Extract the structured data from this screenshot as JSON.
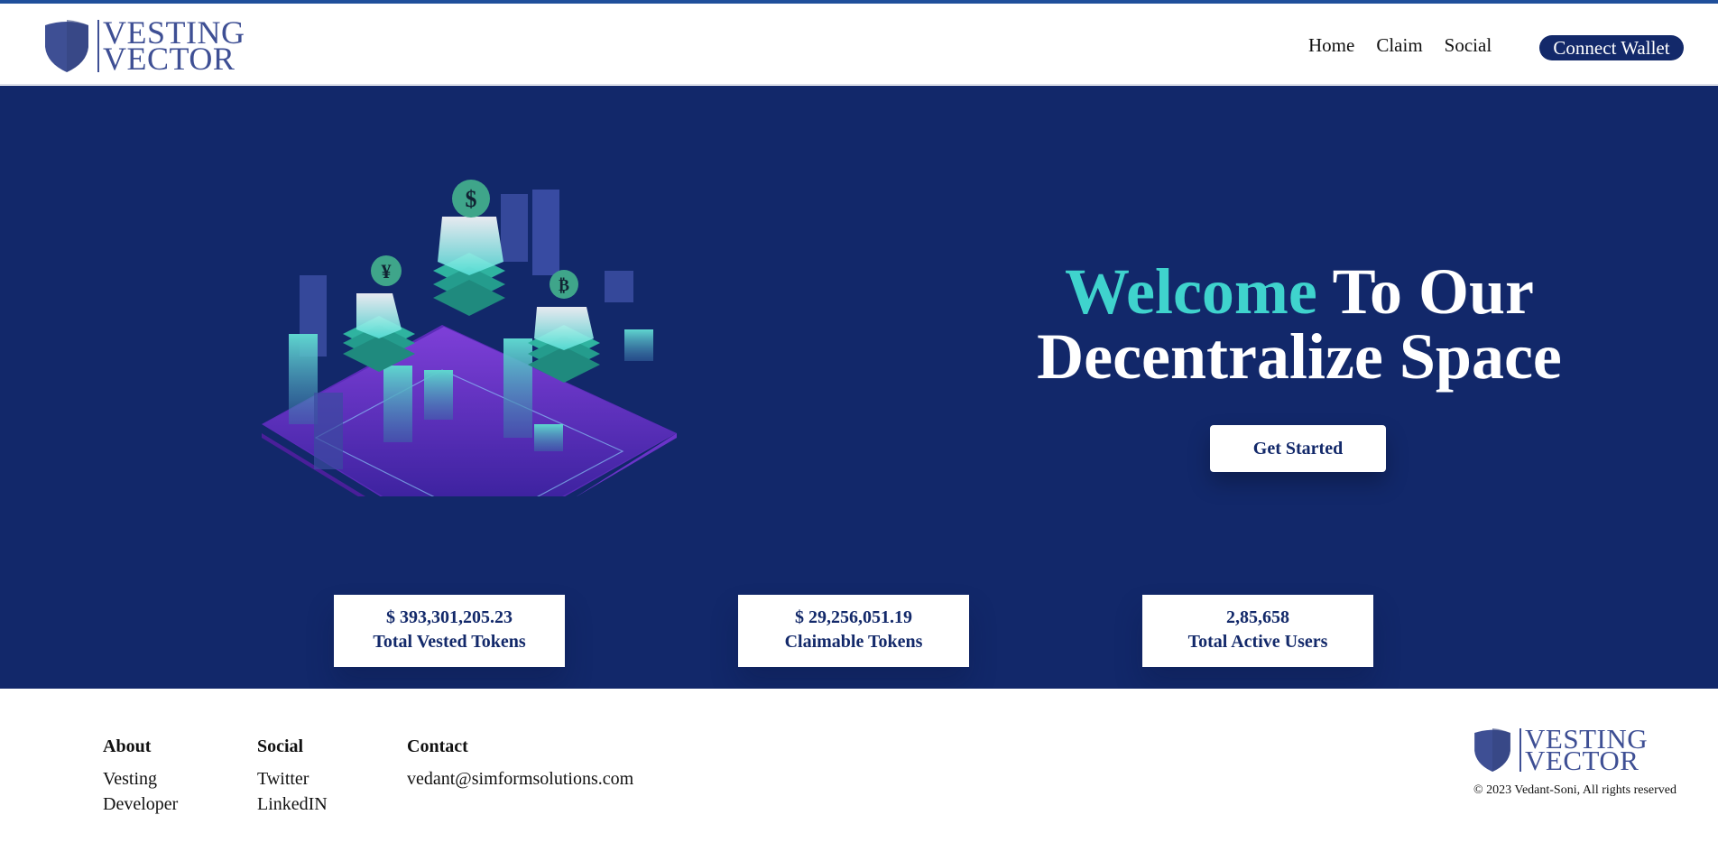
{
  "brand": {
    "line1": "VESTING",
    "line2": "VECTOR"
  },
  "nav": {
    "home": "Home",
    "claim": "Claim",
    "social": "Social",
    "connect": "Connect Wallet"
  },
  "hero": {
    "title_accent": "Welcome",
    "title_rest_1": " To Our",
    "title_line_2": "Decentralize Space",
    "cta": "Get Started",
    "coin_symbols": [
      "$",
      "¥",
      "₿"
    ]
  },
  "stats": [
    {
      "value": "$ 393,301,205.23",
      "label": "Total Vested Tokens"
    },
    {
      "value": "$ 29,256,051.19",
      "label": "Claimable Tokens"
    },
    {
      "value": "2,85,658",
      "label": "Total Active Users"
    }
  ],
  "footer": {
    "about": {
      "heading": "About",
      "links": [
        "Vesting",
        "Developer"
      ]
    },
    "social": {
      "heading": "Social",
      "links": [
        "Twitter",
        "LinkedIN"
      ]
    },
    "contact": {
      "heading": "Contact",
      "email": "vedant@simformsolutions.com"
    },
    "copyright": "© 2023 Vedant-Soni, All rights reserved"
  },
  "colors": {
    "navy": "#12286a",
    "accent": "#3fd3cd",
    "logo": "#3e4f94",
    "topbar": "#1f4f9b"
  },
  "icons": [
    "shield-logo-icon",
    "isometric-crypto-illustration"
  ]
}
